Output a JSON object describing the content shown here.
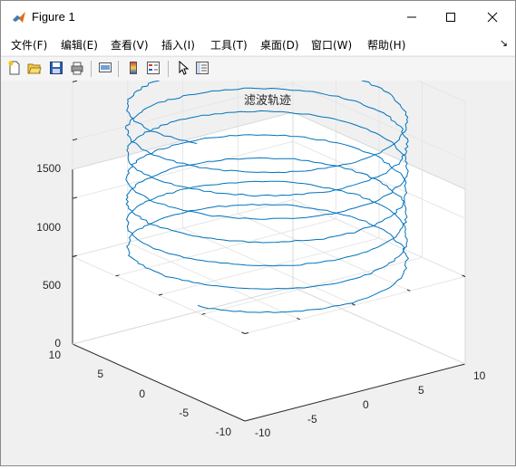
{
  "window": {
    "title": "Figure 1",
    "minimize": "—",
    "maximize": "☐",
    "close": "✕"
  },
  "menu": [
    {
      "label": "文件(F)"
    },
    {
      "label": "编辑(E)"
    },
    {
      "label": "查看(V)"
    },
    {
      "label": "插入(I)"
    },
    {
      "label": "工具(T)"
    },
    {
      "label": "桌面(D)"
    },
    {
      "label": "窗口(W)"
    },
    {
      "label": "帮助(H)"
    }
  ],
  "toolbar": [
    "new-file-icon",
    "open-folder-icon",
    "save-icon",
    "print-icon",
    "link-plot-icon",
    "insert-colorbar-icon",
    "insert-legend-icon",
    "edit-plot-arrow-icon",
    "property-inspector-icon"
  ],
  "chart_data": {
    "type": "line",
    "title": "滤波轨迹",
    "xlim": [
      -10,
      10
    ],
    "ylim": [
      -10,
      10
    ],
    "zlim": [
      0,
      1500
    ],
    "x_ticks": [
      "-10",
      "-5",
      "0",
      "5",
      "10"
    ],
    "y_ticks": [
      "-10",
      "-5",
      "0",
      "5",
      "10"
    ],
    "z_ticks": [
      "0",
      "500",
      "1000",
      "1500"
    ],
    "grid": true,
    "series": [
      {
        "color": "#0072bd",
        "description": "helix, radius ≈ 10, about 7 turns, z from ≈ 0 to ≈ 1400"
      }
    ]
  }
}
